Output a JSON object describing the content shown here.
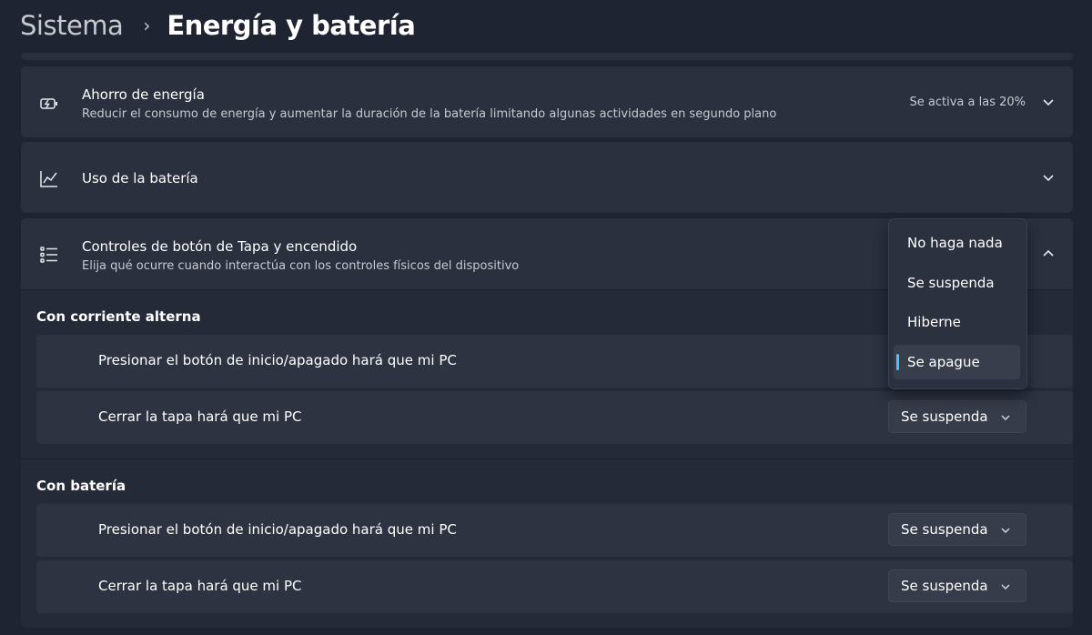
{
  "breadcrumb": {
    "parent": "Sistema",
    "separator": "›",
    "current": "Energía y batería"
  },
  "cards": {
    "power_saver": {
      "title": "Ahorro de energía",
      "description": "Reducir el consumo de energía y aumentar la duración de la batería limitando algunas actividades en segundo plano",
      "status": "Se activa a las 20%",
      "icon": "battery-saver-icon"
    },
    "battery_usage": {
      "title": "Uso de la batería",
      "icon": "chart-line-icon"
    },
    "lid_power": {
      "title": "Controles de botón de Tapa y encendido",
      "description": "Elija qué ocurre cuando interactúa con los controles físicos del dispositivo",
      "icon": "list-settings-icon"
    }
  },
  "sections": {
    "ac": {
      "title": "Con corriente alterna",
      "power_button_label": "Presionar el botón de inicio/apagado hará que mi PC",
      "lid_label": "Cerrar la tapa hará que mi PC",
      "lid_value": "Se suspenda"
    },
    "battery": {
      "title": "Con batería",
      "power_button_label": "Presionar el botón de inicio/apagado hará que mi PC",
      "power_button_value": "Se suspenda",
      "lid_label": "Cerrar la tapa hará que mi PC",
      "lid_value": "Se suspenda"
    }
  },
  "dropdown": {
    "options": [
      "No haga nada",
      "Se suspenda",
      "Hiberne",
      "Se apague"
    ],
    "selected": "Se apague"
  },
  "colors": {
    "background": "#1f2433",
    "card": "#2b303f",
    "accent": "#4cc2ff"
  }
}
